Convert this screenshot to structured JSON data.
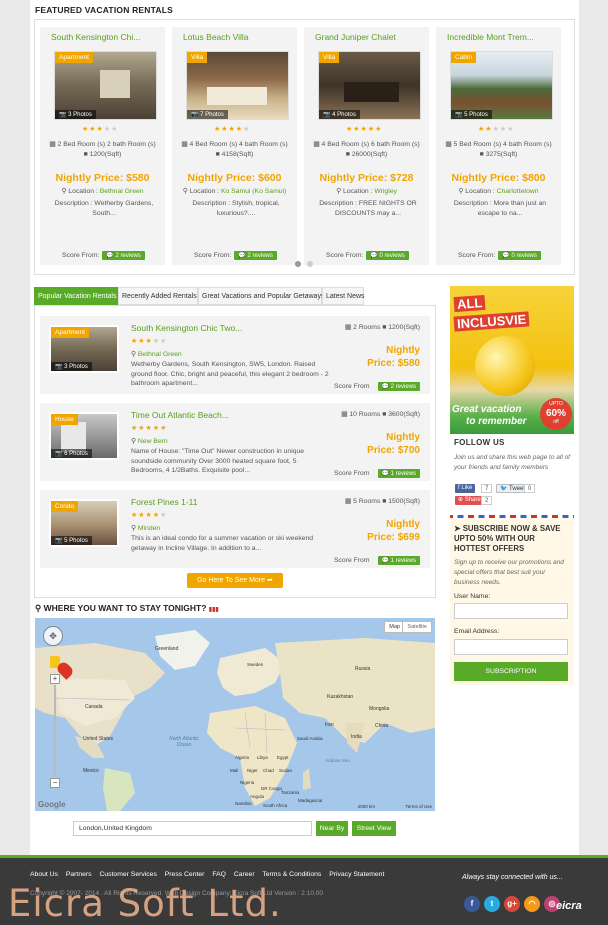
{
  "featured": {
    "title": "FEATURED VACATION RENTALS",
    "cards": [
      {
        "name": "South Kensington Chi...",
        "tag": "Apartment",
        "photos": "3 Photos",
        "stars": 3,
        "rooms": "2 Bed Room (s) 2 bath Room (s)",
        "size": "1200(Sqft)",
        "price": "Nightly Price: $580",
        "loc_label": "Location :",
        "location": "Bethnal Green",
        "desc": "Description :  Wetherby Gardens, South...",
        "score_label": "Score From:",
        "reviews": "2 reviews"
      },
      {
        "name": "Lotus Beach Villa",
        "tag": "Villa",
        "photos": "7 Photos",
        "stars": 4,
        "rooms": "4 Bed Room (s) 4 bath Room (s)",
        "size": "4158(Sqft)",
        "price": "Nightly Price: $600",
        "loc_label": "Location :",
        "location": "Ko Samui (Ko Samui)",
        "desc": "Description : Stylish, tropical, luxurious?....",
        "score_label": "Score From:",
        "reviews": "2 reviews"
      },
      {
        "name": "Grand Juniper Chalet",
        "tag": "Villa",
        "photos": "4 Photos",
        "stars": 5,
        "rooms": "4 Bed Room (s) 6 bath Room (s)",
        "size": "26000(Sqft)",
        "price": "Nightly Price: $728",
        "loc_label": "Location :",
        "location": "Wrigley",
        "desc": "Description : FREE NIGHTS OR DISCOUNTS may a...",
        "score_label": "Score From:",
        "reviews": "0 reviews"
      },
      {
        "name": "Incredible Mont Trem...",
        "tag": "Cabin",
        "photos": "5 Photos",
        "stars": 2,
        "rooms": "5 Bed Room (s) 4 bath Room (s)",
        "size": "3275(Sqft)",
        "price": "Nightly Price: $800",
        "loc_label": "Location :",
        "location": "Charlottetown",
        "desc": "Description : More than just an escape to na...",
        "score_label": "Score From:",
        "reviews": "0 reviews"
      }
    ]
  },
  "tabs": [
    "Popular Vacation Rentals",
    "Recently Added Rentals",
    "Great Vacations and Popular Getaways",
    "Latest News"
  ],
  "listings": [
    {
      "name": "South Kensington Chic Two...",
      "tag": "Apartment",
      "photos": "3 Photos",
      "stars": 3,
      "location": "Bethnal Green",
      "desc": "Wetherby Gardens, South Kensington, SW5, London. Raised ground floor. Chic, bright and peaceful, this elegant 2 bedroom - 2 bathroom apartment...",
      "rooms": "2 Rooms",
      "size": "1200(Sqft)",
      "nightly": "Nightly",
      "price": "Price: $580",
      "score_label": "Score From",
      "reviews": "2 reviews"
    },
    {
      "name": "Time Out Atlantic Beach...",
      "tag": "House",
      "photos": "6 Photos",
      "stars": 5,
      "location": "New Bern",
      "desc": "Name of House: \"Time Out\" Newer construction in unique soundside community Over 3000 heated square foot, 5 Bedrooms, 4 1/2Baths. Exquisite pool...",
      "rooms": "10 Rooms",
      "size": "3600(Sqft)",
      "nightly": "Nightly",
      "price": "Price: $700",
      "score_label": "Score From",
      "reviews": "1 reviews"
    },
    {
      "name": "Forest Pines 1-11",
      "tag": "Condo",
      "photos": "5 Photos",
      "stars": 4,
      "location": "Minden",
      "desc": "This is an ideal condo for a summer vacation or ski weekend getaway in Incline Village. In addition to a...",
      "rooms": "5 Rooms",
      "size": "1500(Sqft)",
      "nightly": "Nightly",
      "price": "Price: $699",
      "score_label": "Score From",
      "reviews": "1 reviews"
    }
  ],
  "see_more": "Go Here To See More",
  "map": {
    "title": "WHERE YOU WANT TO STAY TONIGHT?",
    "map_btn": "Map",
    "satellite_btn": "Satellite",
    "labels": [
      "Greenland",
      "Canada",
      "United States",
      "Mexico",
      "North Atlantic Ocean",
      "Algeria",
      "Libya",
      "Egypt",
      "Mali",
      "Niger",
      "Chad",
      "Sudan",
      "Nigeria",
      "DR Congo",
      "Angola",
      "Namibia",
      "South Africa",
      "Kazakhstan",
      "Mongolia",
      "China",
      "India",
      "Iran",
      "Saudi Arabia",
      "Russia",
      "Tanzania",
      "Madagascar",
      "Arabian Sea",
      "Sweden"
    ],
    "google": "Google",
    "scale": "2000 km",
    "terms": "Terms of Use",
    "input_value": "London,United Kingdom",
    "near_by": "Near By",
    "street_view": "Street View"
  },
  "sidebar": {
    "banner_line1": "ALL",
    "banner_line2": "INCLUSVIE",
    "banner_line3": "Great vacation",
    "banner_line4": "to remember",
    "badge_upto": "UPTO",
    "badge_pct": "60%",
    "badge_off": "off",
    "follow_title": "FOLLOW US",
    "follow_text": "Join us and share this web page to all of your friends and family members",
    "like": "Like",
    "like_count": "7",
    "tweet": "Tweet",
    "tweet_count": "0",
    "share": "Share",
    "share_count": "2",
    "sub_title": "SUBSCRIBE NOW & SAVE UPTO 50% WITH OUR HOTTEST OFFERS",
    "sub_text": "Sign up to receive our promotions and special offers that best suit your business needs.",
    "username_label": "User Name:",
    "email_label": "Email Address:",
    "sub_btn": "SUBSCRIPTION"
  },
  "footer": {
    "links": [
      "About Us",
      "Partners",
      "Customer Services",
      "Press Center",
      "FAQ",
      "Career",
      "Terms & Conditions",
      "Privacy Statement"
    ],
    "copyright": "Copyright © 2007- 2014 . All Rights Reserved. Web Design Company: Eicra Soft Ltd Version : 2.10.00",
    "watermark": "Eicra Soft Ltd.",
    "stay": "Always stay connected with us...",
    "logo": "eicra"
  },
  "colors": {
    "accent_green": "#5aaa2a",
    "accent_orange": "#f0a500",
    "link_green": "#5a9e1f"
  }
}
